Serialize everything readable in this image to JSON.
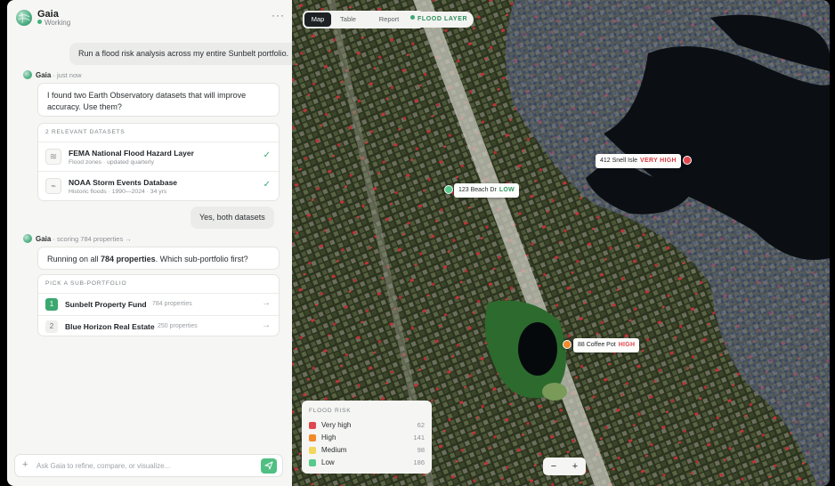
{
  "header": {
    "app_name": "Gaia",
    "status": "Working",
    "more_icon": "ellipsis-icon"
  },
  "messages": {
    "user1": "Run a flood risk analysis across my entire Sunbelt portfolio.",
    "meta1": {
      "name": "Gaia",
      "time": "· just now"
    },
    "assistant1": "I found two Earth Observatory datasets that will improve accuracy. Use them?",
    "datasets": {
      "title": "2 RELEVANT DATASETS",
      "items": [
        {
          "name": "FEMA National Flood Hazard Layer",
          "sub": "Flood zones · updated quarterly",
          "icon": "waves-icon"
        },
        {
          "name": "NOAA Storm Events Database",
          "sub": "Historic floods · 1990—2024 · 34 yrs",
          "icon": "pulse-icon"
        }
      ]
    },
    "user2": "Yes, both datasets",
    "meta2": {
      "name": "Gaia",
      "time": "· scoring 784 properties →"
    },
    "assistant2": {
      "pre": "Running on all ",
      "bold": "784 properties",
      "post": ". Which sub-portfolio first?"
    },
    "portfolios": {
      "title": "PICK A SUB-PORTFOLIO",
      "items": [
        {
          "num": "1",
          "name": "Sunbelt Property Fund",
          "count": "784 properties"
        },
        {
          "num": "2",
          "name": "Blue Horizon Real Estate",
          "count": "250 properties"
        }
      ]
    }
  },
  "composer": {
    "placeholder": "Ask Gaia to refine, compare, or visualize..."
  },
  "map": {
    "tabs": [
      "Map",
      "Table",
      "Report"
    ],
    "active_tab": "Map",
    "layer_pill": "FLOOD LAYER",
    "pins": [
      {
        "address": "412 Snell Isle",
        "risk": "VERY HIGH",
        "color": "#e0464f"
      },
      {
        "address": "123 Beach Dr",
        "risk": "LOW",
        "color": "#58c98b"
      },
      {
        "address": "88 Coffee Pot",
        "risk": "HIGH",
        "color": "#f08a2a"
      }
    ],
    "legend": {
      "title": "FLOOD RISK",
      "rows": [
        {
          "label": "Very high",
          "count": "62",
          "color": "#e0464f"
        },
        {
          "label": "High",
          "count": "141",
          "color": "#f08a2a"
        },
        {
          "label": "Medium",
          "count": "98",
          "color": "#f2d75c"
        },
        {
          "label": "Low",
          "count": "186",
          "color": "#58c98b"
        }
      ]
    },
    "zoom": {
      "out": "−",
      "in": "+"
    }
  },
  "colors": {
    "accent": "#3aa86f",
    "very_high": "#e0464f",
    "high": "#f08a2a",
    "low_text": "#2e9a5f"
  }
}
